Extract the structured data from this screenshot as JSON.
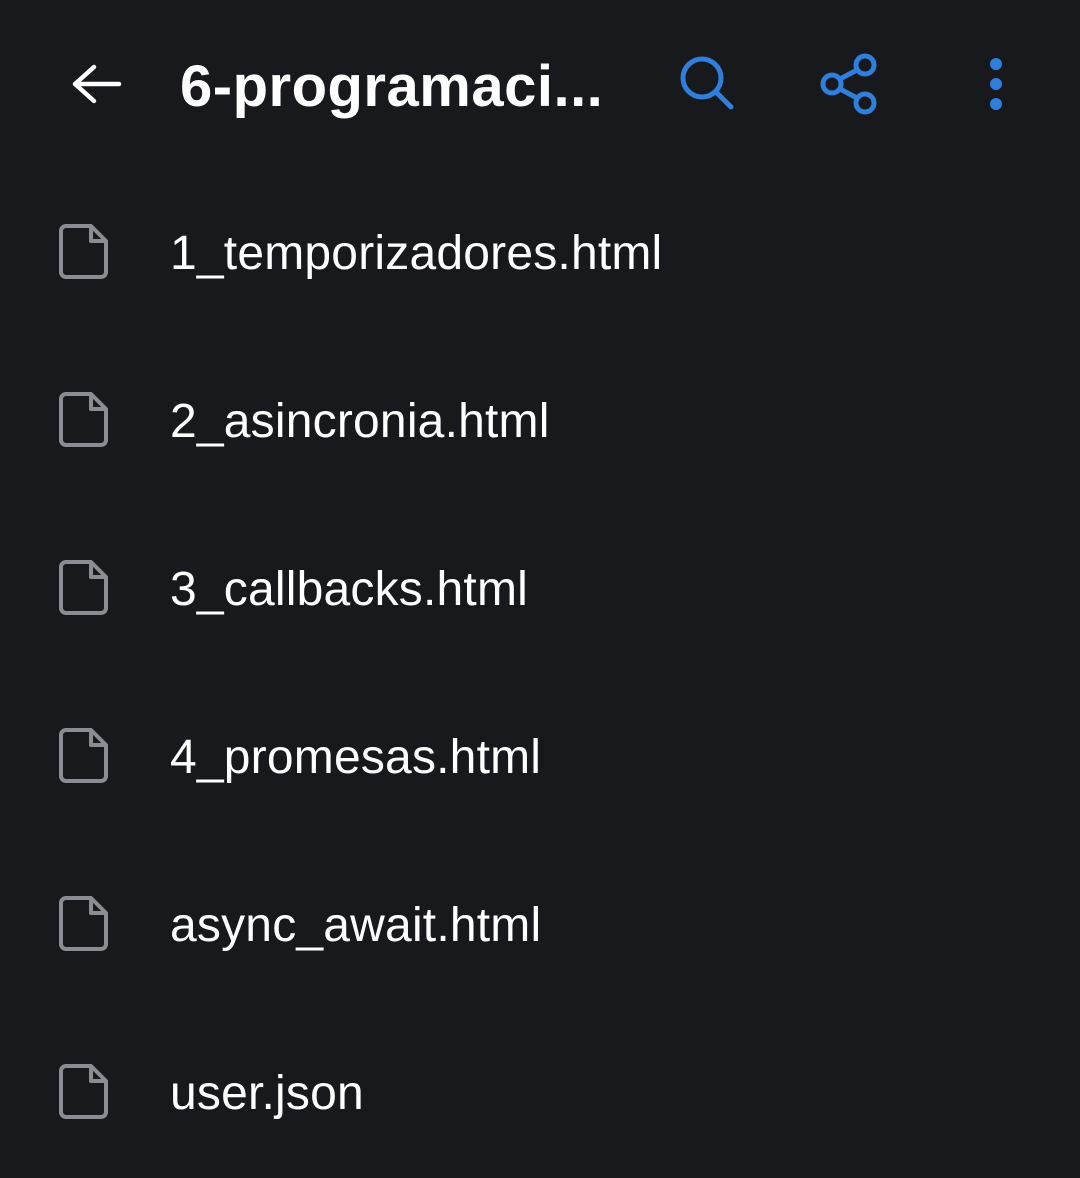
{
  "header": {
    "title": "6-programaci...",
    "back_icon": "arrow-left-icon",
    "search_icon": "search-icon",
    "share_icon": "share-icon",
    "more_icon": "more-vertical-icon",
    "accent_color": "#2f7fdd"
  },
  "files": [
    {
      "name": "1_temporizadores.html",
      "icon": "file-icon"
    },
    {
      "name": "2_asincronia.html",
      "icon": "file-icon"
    },
    {
      "name": "3_callbacks.html",
      "icon": "file-icon"
    },
    {
      "name": "4_promesas.html",
      "icon": "file-icon"
    },
    {
      "name": "async_await.html",
      "icon": "file-icon"
    },
    {
      "name": "user.json",
      "icon": "file-icon"
    }
  ],
  "colors": {
    "background": "#18191d",
    "text": "#ffffff",
    "file_icon": "#8b8d95"
  }
}
